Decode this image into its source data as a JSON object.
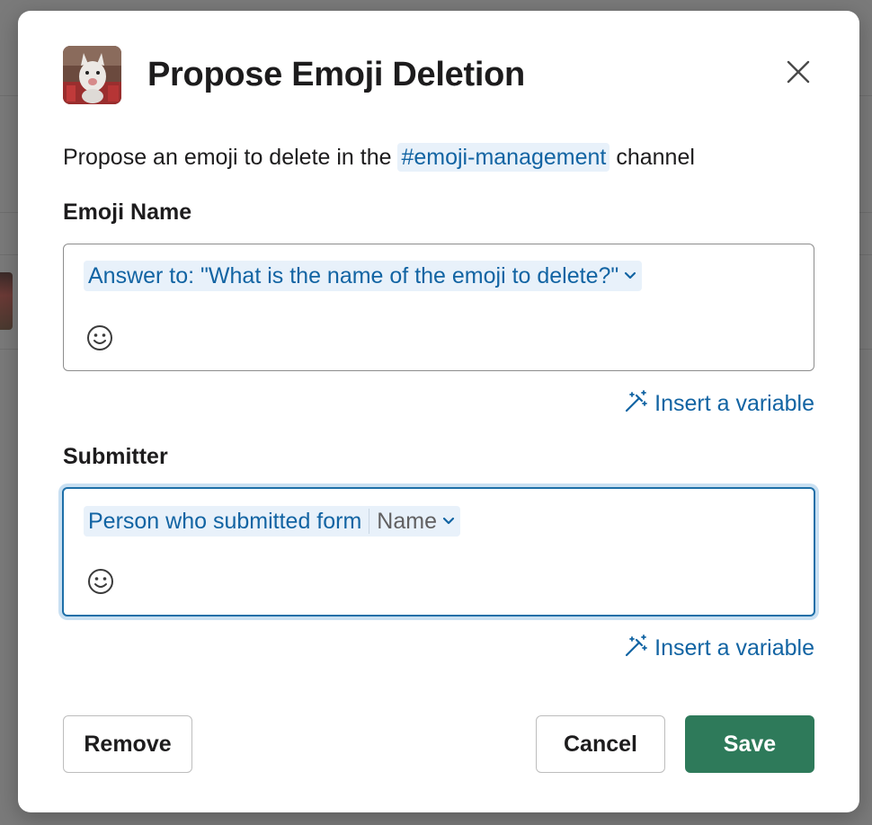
{
  "modal": {
    "title": "Propose Emoji Deletion",
    "description": {
      "prefix": "Propose an emoji to delete in the",
      "channel": "#emoji-management",
      "suffix": "channel"
    }
  },
  "fields": [
    {
      "label": "Emoji Name",
      "token": "Answer to: \"What is the name of the emoji to delete?\"",
      "insert_label": "Insert a variable"
    },
    {
      "label": "Submitter",
      "token": "Person who submitted form",
      "token_sub": "Name",
      "insert_label": "Insert a variable"
    }
  ],
  "buttons": {
    "remove": "Remove",
    "cancel": "Cancel",
    "save": "Save"
  },
  "colors": {
    "accent": "#1264a3",
    "primary_button": "#2e7a5a",
    "focus_ring": "#1d6fa8"
  }
}
